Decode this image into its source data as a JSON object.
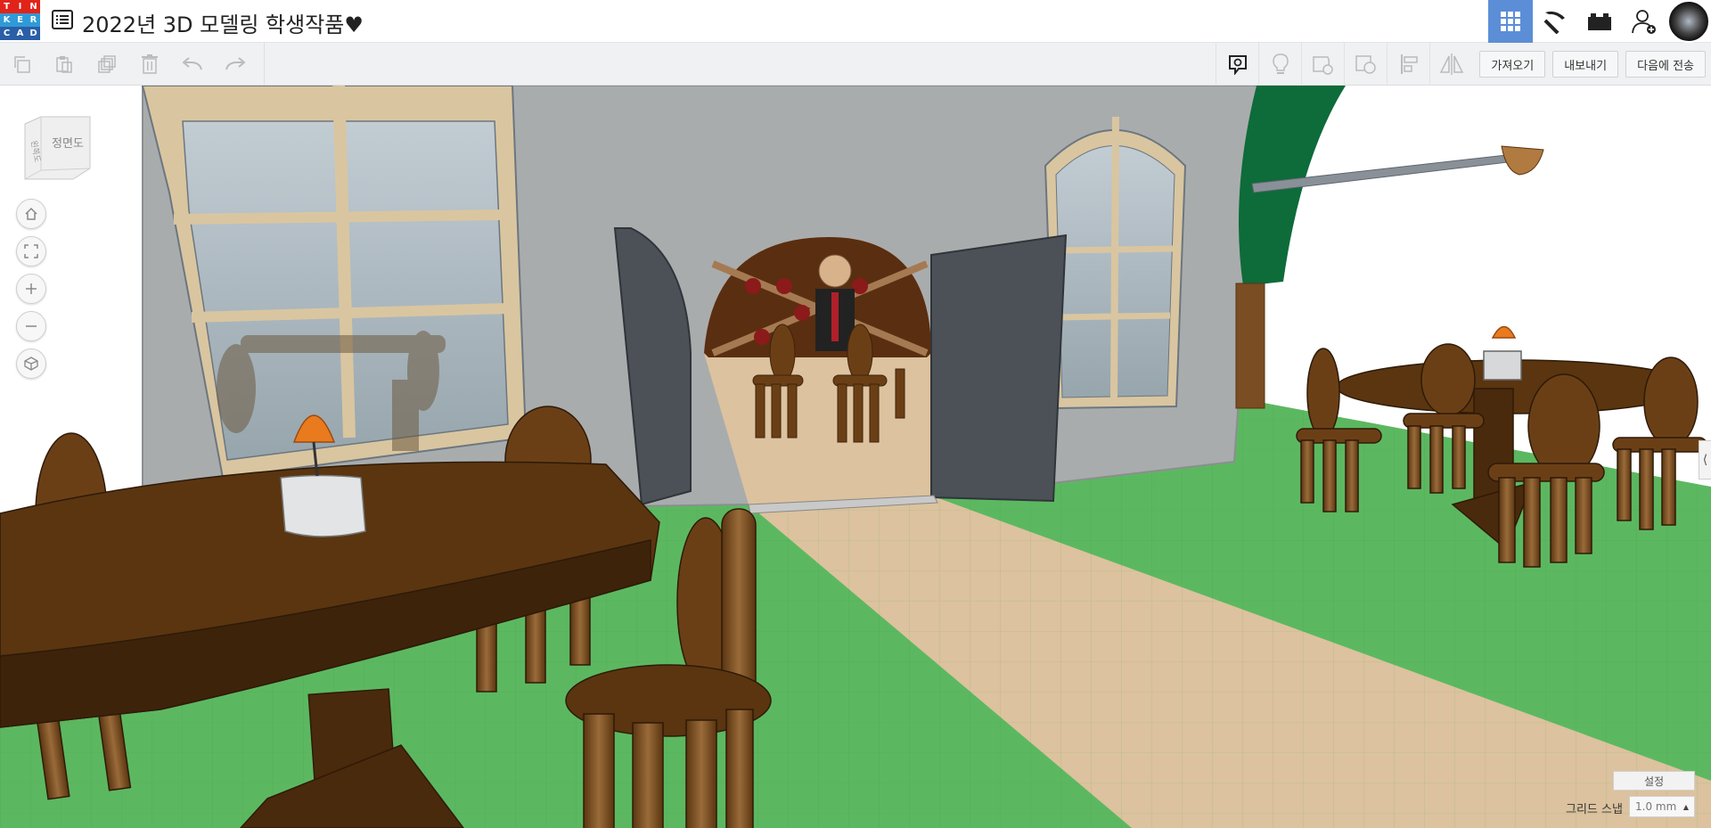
{
  "app": {
    "logo_letters": [
      "T",
      "I",
      "N",
      "K",
      "E",
      "R",
      "C",
      "A",
      "D"
    ],
    "logo_colors": [
      "#e2231a",
      "#e2231a",
      "#e2231a",
      "#2f9ad7",
      "#2f9ad7",
      "#2f9ad7",
      "#2a5ea6",
      "#2a5ea6",
      "#2a5ea6"
    ],
    "title": "2022년 3D 모델링 학생작품♥"
  },
  "top_nav": {
    "items": [
      {
        "icon": "grid-view-icon",
        "active": true
      },
      {
        "icon": "pickaxe-icon",
        "active": false
      },
      {
        "icon": "bricks-icon",
        "active": false
      },
      {
        "icon": "add-user-icon",
        "active": false
      },
      {
        "icon": "user-avatar",
        "active": false
      }
    ]
  },
  "toolbar": {
    "left_tools": [
      "copy-icon",
      "paste-icon",
      "duplicate-icon",
      "delete-icon",
      "undo-icon",
      "redo-icon"
    ],
    "right_tools": [
      "note-icon",
      "lightbulb-icon",
      "workplane-icon",
      "ruler-icon",
      "align-icon",
      "mirror-icon"
    ],
    "import_label": "가져오기",
    "export_label": "내보내기",
    "send_label": "다음에 전송"
  },
  "viewcube": {
    "front_label": "정면도",
    "side_label": "왼쪽도"
  },
  "viewport_controls": [
    "home-icon",
    "fit-icon",
    "zoom-in-icon",
    "zoom-out-icon",
    "perspective-icon"
  ],
  "bottom": {
    "settings_label": "설정",
    "grid_snap_label": "그리드 스냅",
    "grid_snap_value": "1.0 mm"
  },
  "colors": {
    "accent": "#5b8ed6",
    "grass": "#5cb860",
    "floor": "#dcc29e",
    "wall": "#a9acad",
    "wood": "#5a3510"
  }
}
